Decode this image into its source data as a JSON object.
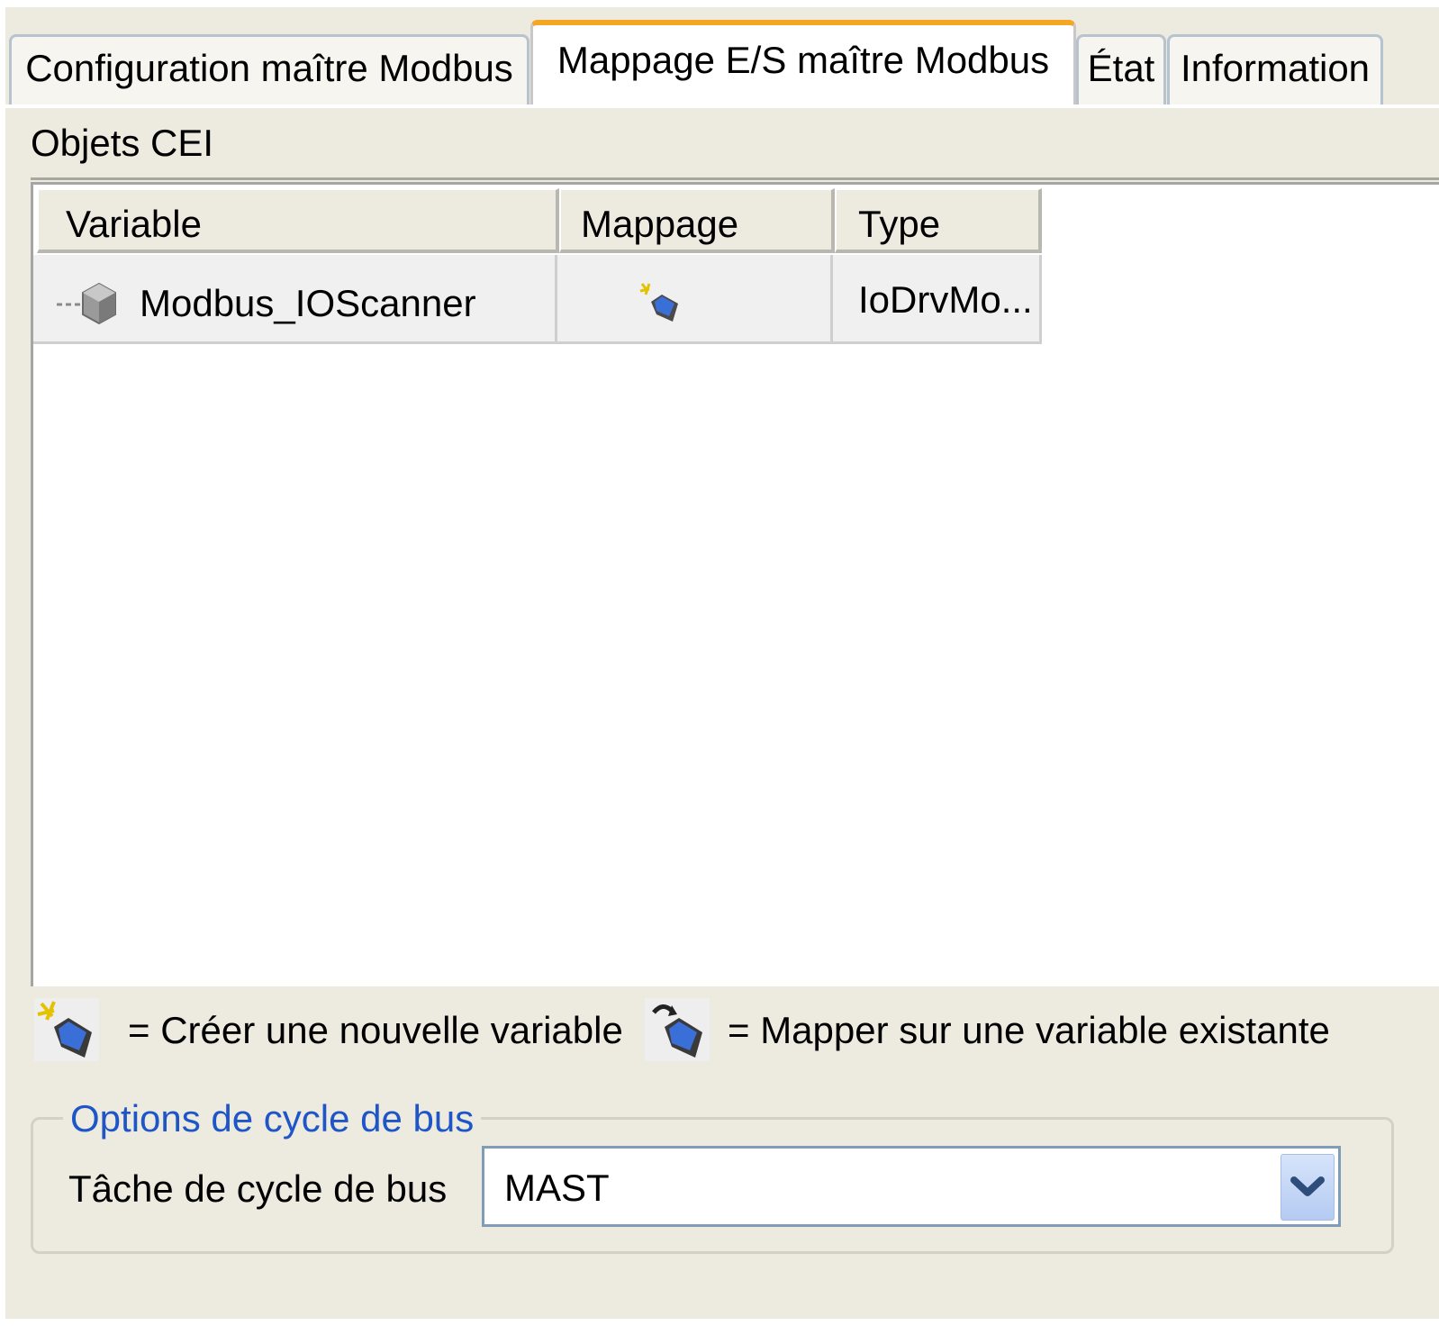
{
  "tabs": [
    {
      "label": "Configuration maître Modbus",
      "active": false
    },
    {
      "label": "Mappage E/S maître Modbus",
      "active": true
    },
    {
      "label": "État",
      "active": false
    },
    {
      "label": "Information",
      "active": false
    }
  ],
  "section": {
    "title": "Objets CEI"
  },
  "table": {
    "headers": [
      "Variable",
      "Mappage",
      "Type"
    ],
    "rows": [
      {
        "variable": "Modbus_IOScanner",
        "mapping_icon": "create-variable-icon",
        "type": "IoDrvMo..."
      }
    ]
  },
  "legend": {
    "create_label": "= Créer une nouvelle variable",
    "map_label": "= Mapper sur une variable existante"
  },
  "bus_cycle": {
    "group_label": "Options de cycle de bus",
    "task_label": "Tâche de cycle de bus",
    "task_value": "MAST"
  },
  "colors": {
    "active_tab_accent": "#f5a623",
    "group_label": "#1e56c8",
    "background": "#edeae0"
  }
}
